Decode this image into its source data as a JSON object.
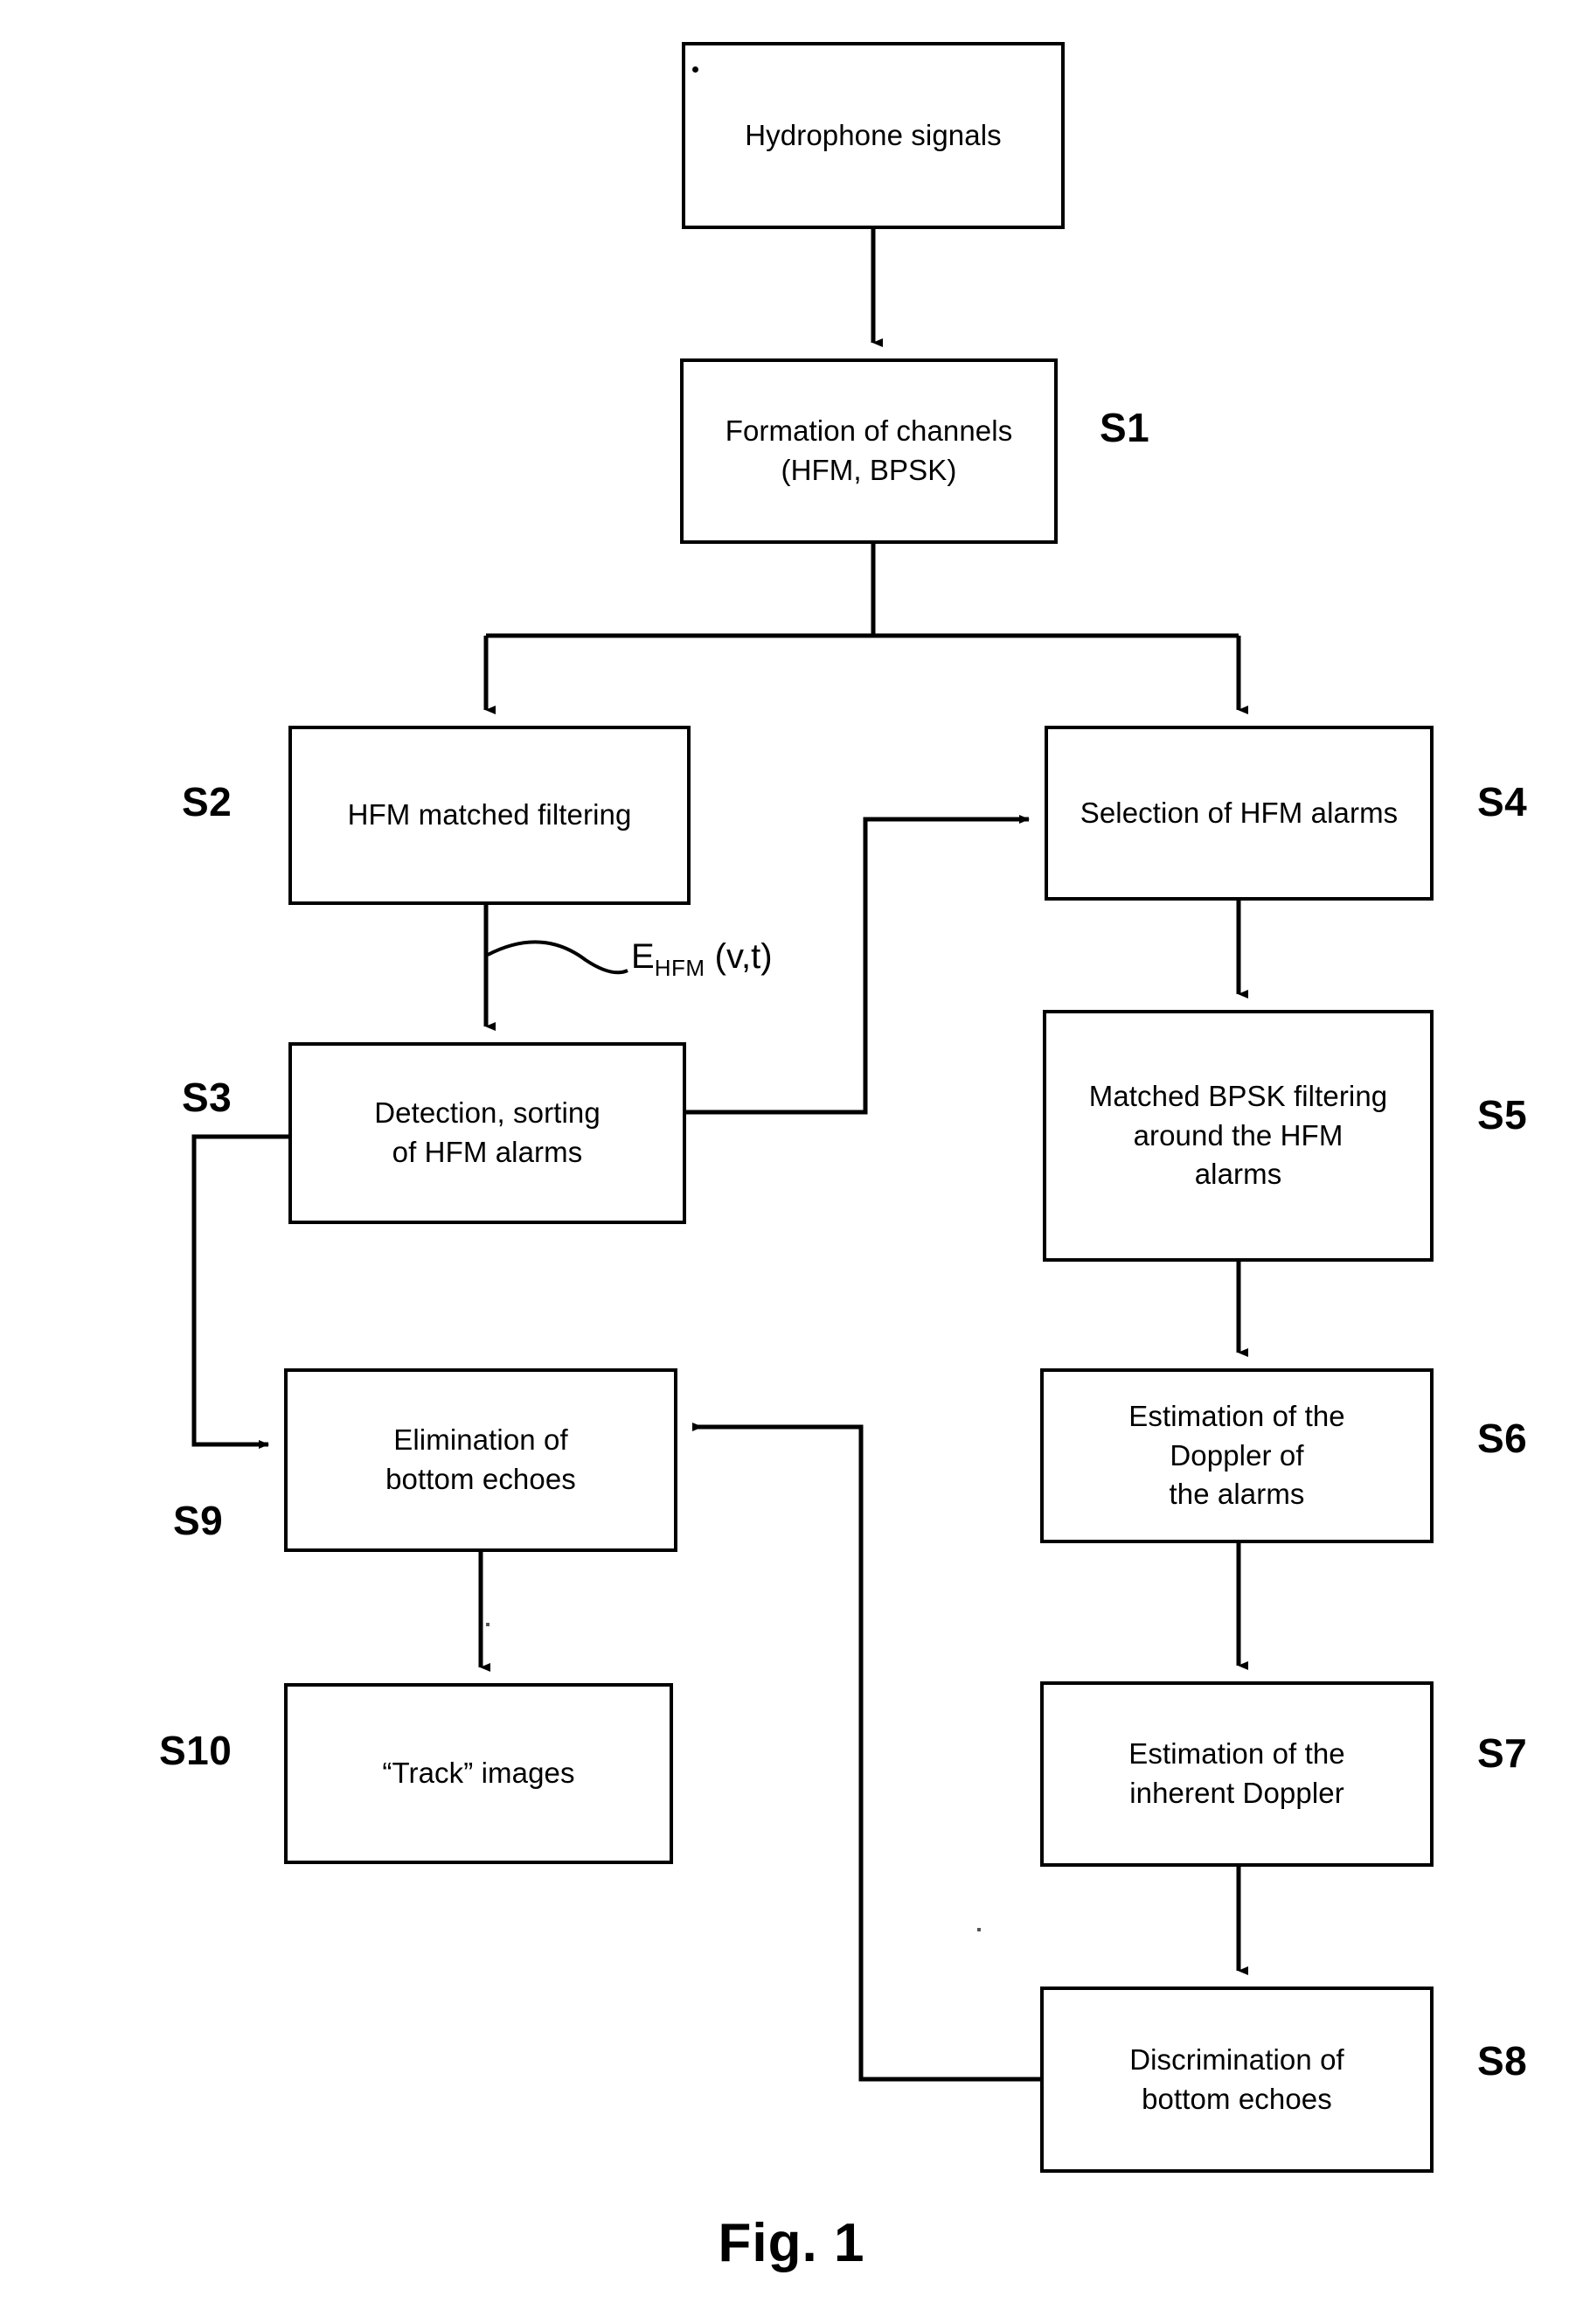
{
  "figure": {
    "caption": "Fig. 1",
    "nodes": {
      "hydrophone": "Hydrophone signals",
      "s1": "Formation of channels\n(HFM, BPSK)",
      "s2": "HFM matched filtering",
      "s3": "Detection, sorting\nof HFM alarms",
      "s4": "Selection of HFM alarms",
      "s5": "Matched BPSK filtering\naround the HFM\nalarms",
      "s6": "Estimation of the\nDoppler of\nthe alarms",
      "s7": "Estimation of the\ninherent Doppler",
      "s8": "Discrimination of\nbottom echoes",
      "s9": "Elimination of\nbottom echoes",
      "s10": "“Track” images"
    },
    "step_tags": {
      "s1": "S1",
      "s2": "S2",
      "s3": "S3",
      "s4": "S4",
      "s5": "S5",
      "s6": "S6",
      "s7": "S7",
      "s8": "S8",
      "s9": "S9",
      "s10": "S10"
    },
    "annotations": {
      "ehfm_base": "E",
      "ehfm_sub": "HFM",
      "ehfm_args": " (v,t)"
    },
    "colors": {
      "stroke": "#000000",
      "background": "#ffffff"
    }
  }
}
